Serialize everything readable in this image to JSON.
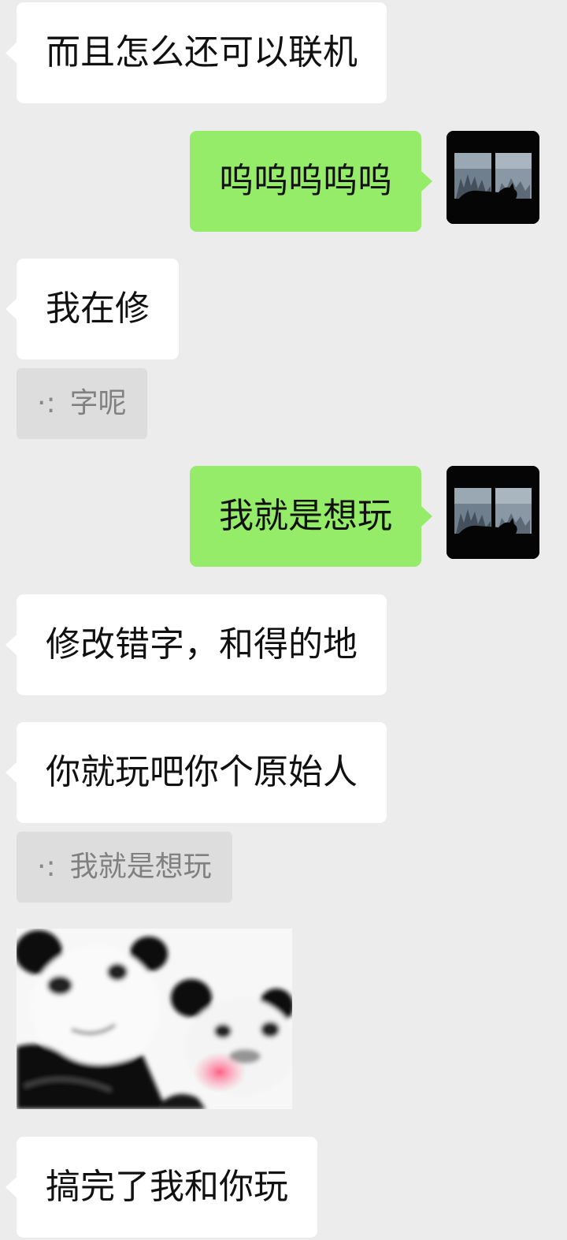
{
  "colors": {
    "background": "#ececec",
    "incoming_bubble": "#ffffff",
    "outgoing_bubble": "#95ec69",
    "quote_bubble": "#dddddd",
    "quote_text": "#808080"
  },
  "messages": [
    {
      "direction": "incoming",
      "text": "而且怎么还可以联机"
    },
    {
      "direction": "outgoing",
      "text": "呜呜呜呜呜",
      "avatar_icon": "cat-silhouette-window-avatar"
    },
    {
      "direction": "incoming",
      "text": "我在修"
    },
    {
      "direction": "quote",
      "prefix": "·:",
      "text": "字呢"
    },
    {
      "direction": "outgoing",
      "text": "我就是想玩",
      "avatar_icon": "cat-silhouette-window-avatar"
    },
    {
      "direction": "incoming",
      "text": "修改错字，和得的地"
    },
    {
      "direction": "incoming",
      "text": "你就玩吧你个原始人"
    },
    {
      "direction": "quote",
      "prefix": "·:",
      "text": "我就是想玩"
    },
    {
      "direction": "incoming",
      "type": "sticker",
      "icon": "panda-meme-sticker"
    },
    {
      "direction": "incoming",
      "text": "搞完了我和你玩"
    }
  ]
}
